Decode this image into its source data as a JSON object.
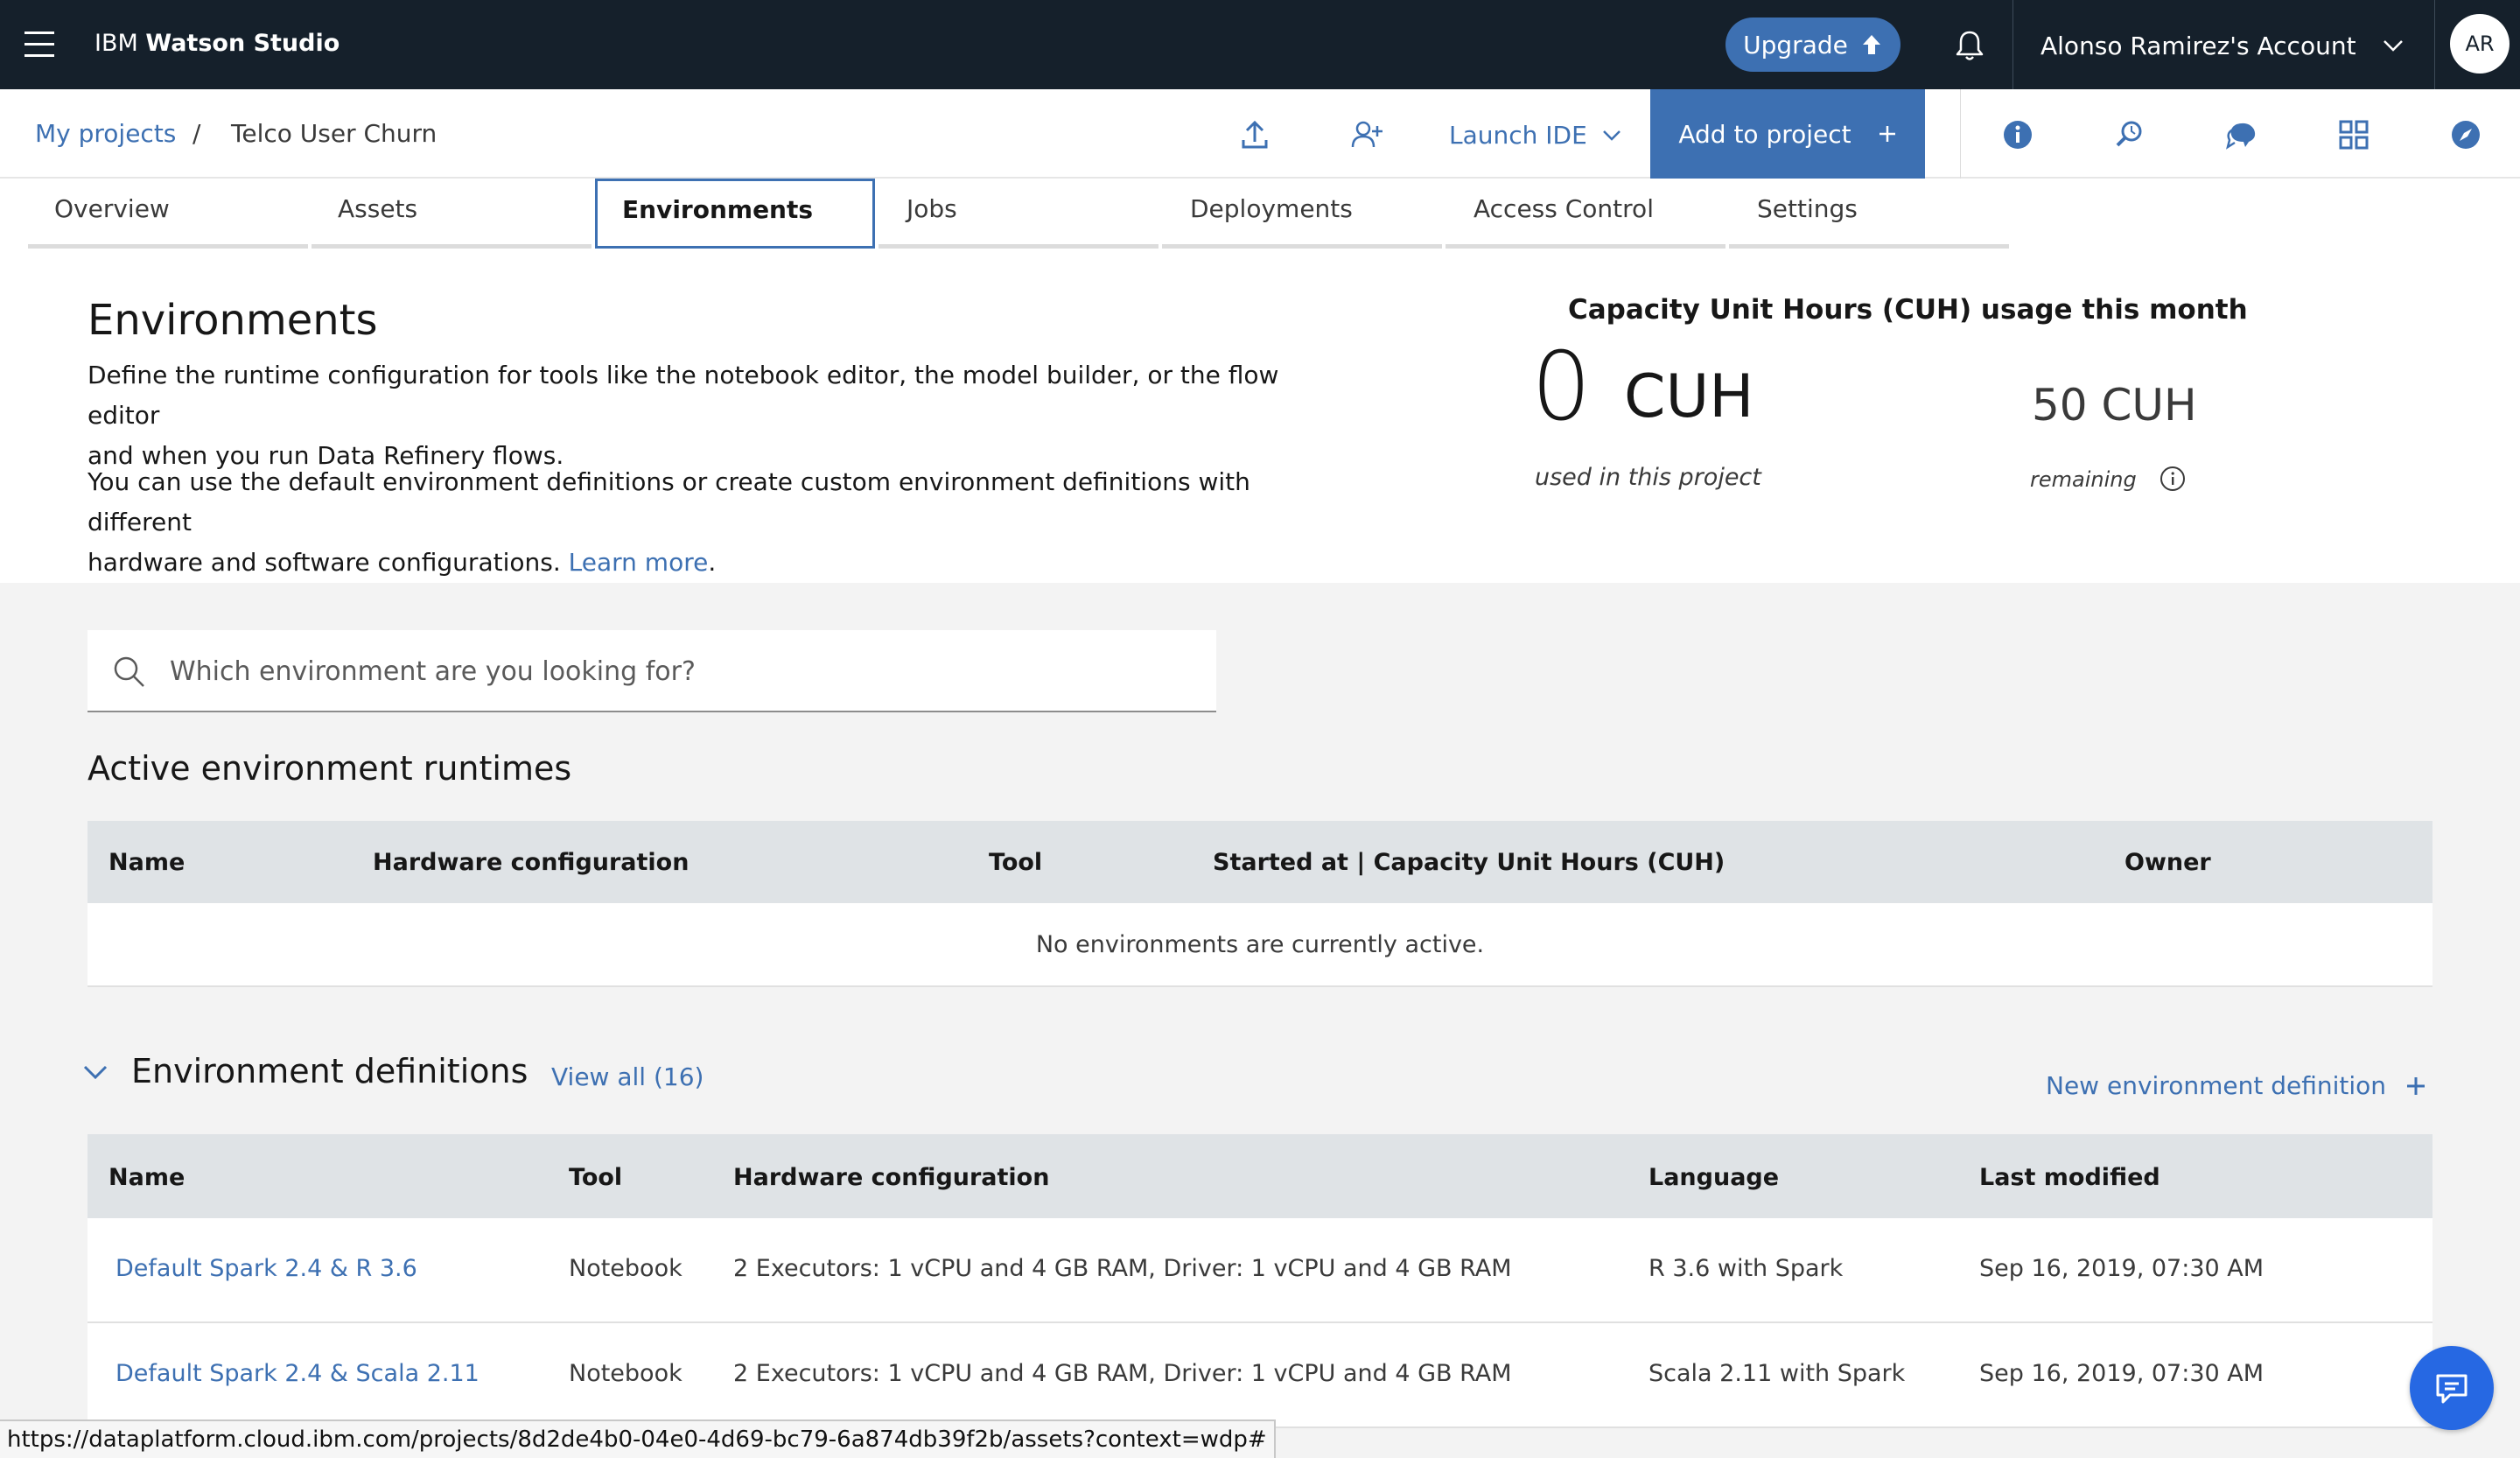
{
  "app": {
    "brand_prefix": "IBM",
    "brand_name": "Watson Studio"
  },
  "topbar": {
    "upgrade_label": "Upgrade",
    "account_label": "Alonso Ramirez's Account",
    "avatar_initials": "AR"
  },
  "breadcrumb": {
    "projects": "My projects",
    "separator": "/",
    "current": "Telco User Churn"
  },
  "toolbar": {
    "launch_ide": "Launch IDE",
    "add_to_project": "Add to project"
  },
  "tabs": [
    {
      "label": "Overview",
      "active": false
    },
    {
      "label": "Assets",
      "active": false
    },
    {
      "label": "Environments",
      "active": true
    },
    {
      "label": "Jobs",
      "active": false
    },
    {
      "label": "Deployments",
      "active": false
    },
    {
      "label": "Access Control",
      "active": false
    },
    {
      "label": "Settings",
      "active": false
    }
  ],
  "header": {
    "title": "Environments",
    "desc1_line1": "Define the runtime configuration for tools like the notebook editor, the model builder, or the flow editor",
    "desc1_line2": "and when you run Data Refinery flows.",
    "desc2_line1": "You can use the default environment definitions or create custom environment definitions with different",
    "desc2_line2": "hardware and software configurations.",
    "learn_more": "Learn more",
    "period": "."
  },
  "cuh": {
    "title": "Capacity Unit Hours (CUH) usage this month",
    "used_value": "0",
    "used_unit": "CUH",
    "used_caption": "used in this project",
    "remaining": "50 CUH",
    "remaining_caption": "remaining"
  },
  "search": {
    "placeholder": "Which environment are you looking for?"
  },
  "active_runtimes": {
    "title": "Active environment runtimes",
    "columns": [
      "Name",
      "Hardware configuration",
      "Tool",
      "Started at | Capacity Unit Hours (CUH)",
      "Owner"
    ],
    "empty_message": "No environments are currently active."
  },
  "definitions": {
    "title": "Environment definitions",
    "view_all": "View all (16)",
    "new_label": "New environment definition",
    "columns": [
      "Name",
      "Tool",
      "Hardware configuration",
      "Language",
      "Last modified"
    ],
    "rows": [
      [
        "Default Spark 2.4 & R 3.6",
        "Notebook",
        "2 Executors: 1 vCPU and 4 GB RAM, Driver: 1 vCPU and 4 GB RAM",
        "R 3.6 with Spark",
        "Sep 16, 2019, 07:30 AM"
      ],
      [
        "Default Spark 2.4 & Scala 2.11",
        "Notebook",
        "2 Executors: 1 vCPU and 4 GB RAM, Driver: 1 vCPU and 4 GB RAM",
        "Scala 2.11 with Spark",
        "Sep 16, 2019, 07:30 AM"
      ]
    ]
  },
  "status_url": "https://dataplatform.cloud.ibm.com/projects/8d2de4b0-04e0-4d69-bc79-6a874db39f2b/assets?context=wdp#",
  "colors": {
    "topbar": "#15202b",
    "accent": "#3d70b2",
    "header_row": "#dfe3e6",
    "chat": "#2668e3"
  }
}
